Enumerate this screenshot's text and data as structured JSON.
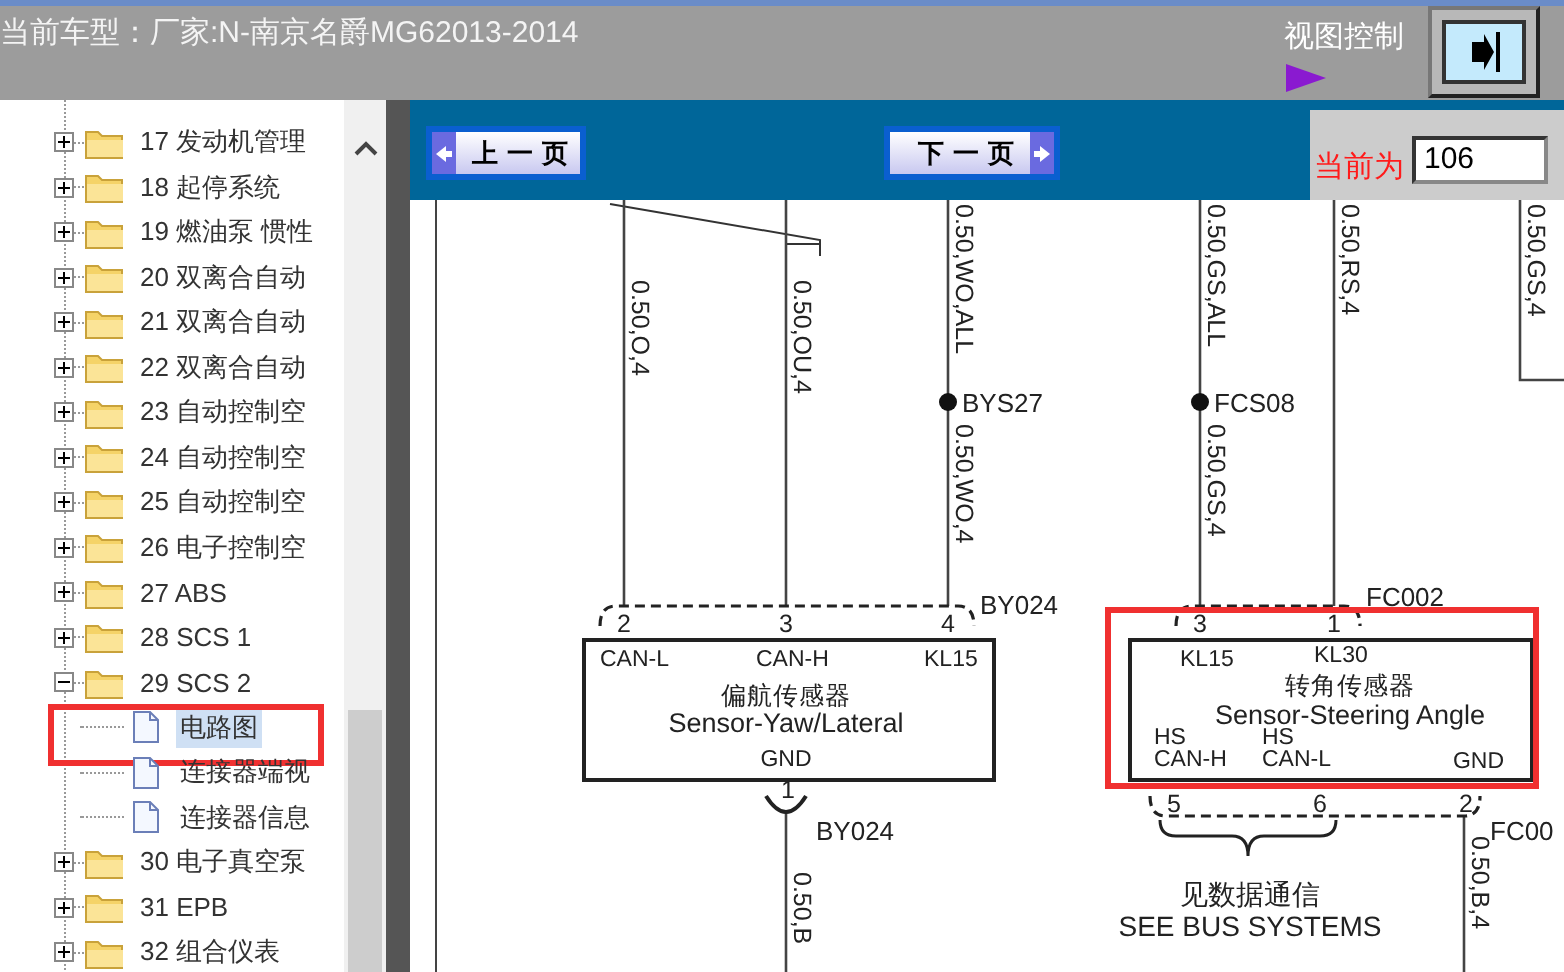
{
  "header": {
    "vehicle": "当前车型：厂家:N-南京名爵MG62013-2014",
    "view_control": "视图控制"
  },
  "tree": {
    "items": [
      {
        "label": "17 发动机管理",
        "expanded": false
      },
      {
        "label": "18 起停系统",
        "expanded": false
      },
      {
        "label": "19 燃油泵 惯性",
        "expanded": false
      },
      {
        "label": "20 双离合自动",
        "expanded": false
      },
      {
        "label": "21 双离合自动",
        "expanded": false
      },
      {
        "label": "22 双离合自动",
        "expanded": false
      },
      {
        "label": "23 自动控制空",
        "expanded": false
      },
      {
        "label": "24 自动控制空",
        "expanded": false
      },
      {
        "label": "25 自动控制空",
        "expanded": false
      },
      {
        "label": "26 电子控制空",
        "expanded": false
      },
      {
        "label": "27 ABS",
        "expanded": false
      },
      {
        "label": "28 SCS 1",
        "expanded": false
      },
      {
        "label": "29 SCS 2",
        "expanded": true,
        "children": [
          {
            "label": "电路图",
            "selected": true,
            "highlighted": true
          },
          {
            "label": "连接器端视",
            "selected": false,
            "highlighted": false
          },
          {
            "label": "连接器信息",
            "selected": false,
            "highlighted": false
          }
        ]
      },
      {
        "label": "30 电子真空泵",
        "expanded": false
      },
      {
        "label": "31 EPB",
        "expanded": false
      },
      {
        "label": "32 组合仪表",
        "expanded": false
      }
    ]
  },
  "toolbar": {
    "prev": "上 一 页",
    "next": "下 一 页",
    "page_label": "当前为",
    "page_value": "106"
  },
  "diagram": {
    "wires": [
      {
        "labels": [
          "0.50,O,4"
        ]
      },
      {
        "labels": [
          "0.50,OU,4"
        ]
      },
      {
        "labels": [
          "0.50,WO,ALL",
          "0.50,WO,4"
        ],
        "splice": "BYS27"
      },
      {
        "labels": [
          "0.50,GS,ALL",
          "0.50,GS,4"
        ],
        "splice": "FCS08"
      },
      {
        "labels": [
          "0.50,RS,4"
        ]
      },
      {
        "labels": [
          "0.50,GS,4"
        ]
      },
      {
        "labels": [
          "0.50,B"
        ]
      },
      {
        "labels": [
          "0.50,B,4"
        ]
      }
    ],
    "components": [
      {
        "name_cn": "偏航传感器",
        "name_en": "Sensor-Yaw/Lateral",
        "highlighted": false,
        "terminals": [
          [
            "CAN-L"
          ],
          [
            "CAN-H"
          ],
          [
            "KL15"
          ],
          [
            "GND"
          ]
        ],
        "connectors": [
          {
            "id": "BY024",
            "pins": [
              "2",
              "3",
              "4"
            ]
          },
          {
            "id": "BY024",
            "pins": [
              "1"
            ]
          }
        ]
      },
      {
        "name_cn": "转角传感器",
        "name_en": "Sensor-Steering Angle",
        "highlighted": true,
        "terminals": [
          [
            "KL15"
          ],
          [
            "KL30"
          ],
          [
            "HS",
            "CAN-H"
          ],
          [
            "HS",
            "CAN-L"
          ],
          [
            "GND"
          ]
        ],
        "connectors": [
          {
            "id": "FC002",
            "pins": [
              "3",
              "1"
            ]
          },
          {
            "id": "FC00",
            "pins": [
              "5",
              "6",
              "2"
            ]
          }
        ]
      }
    ],
    "bus_note": [
      "见数据通信",
      "SEE BUS SYSTEMS"
    ]
  }
}
